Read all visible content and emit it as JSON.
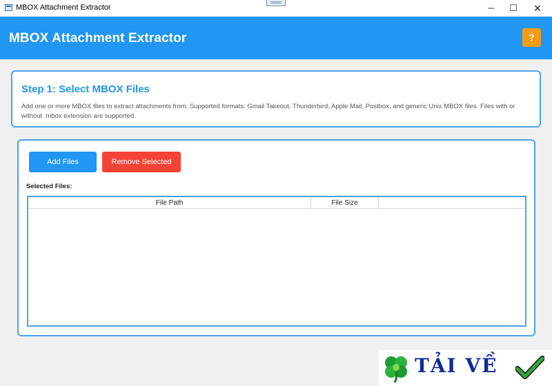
{
  "window": {
    "title": "MBOX Attachment Extractor",
    "minimize_glyph": "─",
    "maximize_glyph": "☐",
    "close_glyph": "✕"
  },
  "header": {
    "title": "MBOX Attachment Extractor",
    "help_label": "?",
    "accent_color": "#2196f3",
    "help_color": "#f39c12"
  },
  "step": {
    "title": "Step 1: Select MBOX Files",
    "description": "Add one or more MBOX files to extract attachments from. Supported formats: Gmail Takeout, Thunderbird, Apple Mail, Postbox, and generic Unix MBOX files. Files with or without .mbox extension are supported."
  },
  "files": {
    "add_label": "Add Files",
    "remove_label": "Remove Selected",
    "remove_color": "#f44336",
    "selected_label": "Selected Files:",
    "columns": [
      "File Path",
      "File Size"
    ],
    "rows": []
  },
  "watermark": {
    "text": "TẢI VỀ",
    "icons": [
      "clover-icon",
      "checkmark-icon"
    ]
  }
}
